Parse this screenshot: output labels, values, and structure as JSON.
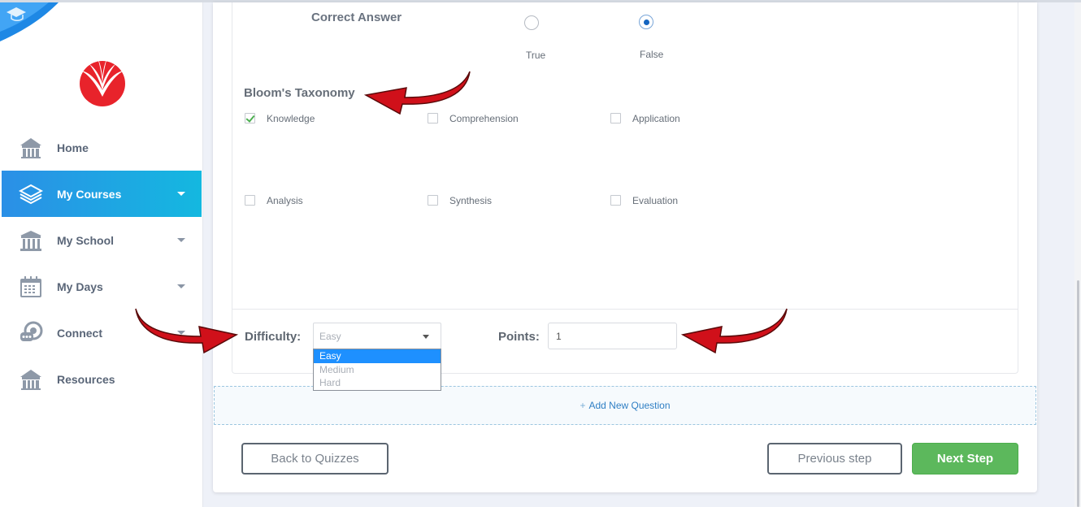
{
  "sidebar": {
    "items": [
      {
        "label": "Home",
        "icon": "school-building-icon",
        "has_caret": false
      },
      {
        "label": "My Courses",
        "icon": "layers-icon",
        "has_caret": true,
        "active": true
      },
      {
        "label": "My School",
        "icon": "columns-building-icon",
        "has_caret": true
      },
      {
        "label": "My Days",
        "icon": "calendar-icon",
        "has_caret": true
      },
      {
        "label": "Connect",
        "icon": "chat-bubbles-icon",
        "has_caret": true
      },
      {
        "label": "Resources",
        "icon": "resources-building-icon",
        "has_caret": false
      }
    ]
  },
  "question": {
    "correct_answer_label": "Correct Answer",
    "options": [
      {
        "label": "True",
        "selected": false
      },
      {
        "label": "False",
        "selected": true
      }
    ]
  },
  "bloom": {
    "title": "Bloom's Taxonomy",
    "items": [
      {
        "label": "Knowledge",
        "checked": true
      },
      {
        "label": "Comprehension",
        "checked": false
      },
      {
        "label": "Application",
        "checked": false
      },
      {
        "label": "Analysis",
        "checked": false
      },
      {
        "label": "Synthesis",
        "checked": false
      },
      {
        "label": "Evaluation",
        "checked": false
      }
    ]
  },
  "difficulty": {
    "label": "Difficulty:",
    "value": "Easy",
    "options": [
      "Easy",
      "Medium",
      "Hard"
    ],
    "highlighted": "Easy"
  },
  "points": {
    "label": "Points:",
    "value": "1"
  },
  "add_question": {
    "plus": "+",
    "label": "Add New Question"
  },
  "buttons": {
    "back": "Back to Quizzes",
    "previous": "Previous step",
    "next": "Next Step"
  },
  "colors": {
    "active_nav_start": "#2b8fe6",
    "active_nav_end": "#14b8e0",
    "next_button": "#5cb85c",
    "annotation_arrow": "#d0101a",
    "logo_red": "#e8232b"
  }
}
